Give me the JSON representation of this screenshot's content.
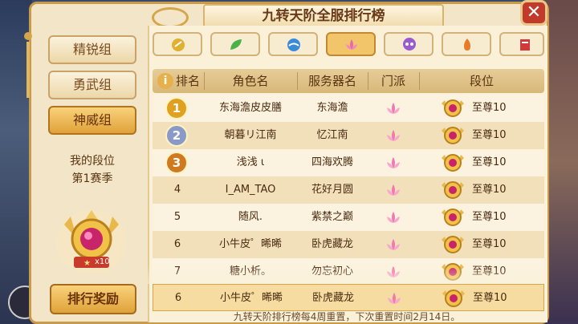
{
  "window": {
    "title": "九转天阶全服排行榜",
    "close_label": "✕"
  },
  "groups": [
    {
      "label": "精锐组",
      "active": false
    },
    {
      "label": "勇武组",
      "active": false
    },
    {
      "label": "神威组",
      "active": true
    }
  ],
  "my_rank": {
    "label": "我的段位",
    "season": "第1赛季",
    "star_count": "x10"
  },
  "reward_button": "排行奖励",
  "sect_tabs": [
    {
      "icon": "gold-orb-icon",
      "color": "#e0b030"
    },
    {
      "icon": "green-leaf-icon",
      "color": "#4ab04a"
    },
    {
      "icon": "blue-wave-icon",
      "color": "#3a8ad8"
    },
    {
      "icon": "pink-lotus-icon",
      "color": "#e86aa8",
      "active": true
    },
    {
      "icon": "purple-skull-icon",
      "color": "#9a5ad0"
    },
    {
      "icon": "orange-flame-icon",
      "color": "#e87a2a"
    },
    {
      "icon": "red-banner-icon",
      "color": "#d03a3a"
    }
  ],
  "table": {
    "headers": {
      "info": "i",
      "rank": "排名",
      "name": "角色名",
      "server": "服务器名",
      "sect": "门派",
      "tier": "段位"
    },
    "rows": [
      {
        "rank": "1",
        "name": "东海澹皮皮膳",
        "server": "东海澹",
        "tier": "至尊10",
        "medal": "gold"
      },
      {
        "rank": "2",
        "name": "朝暮リ江南",
        "server": "忆江南",
        "tier": "至尊10",
        "medal": "silver"
      },
      {
        "rank": "3",
        "name": "浅浅 ι",
        "server": "四海欢腾",
        "tier": "至尊10",
        "medal": "bronze"
      },
      {
        "rank": "4",
        "name": "I_AM_TAO",
        "server": "花好月圆",
        "tier": "至尊10",
        "medal": ""
      },
      {
        "rank": "5",
        "name": "随风.",
        "server": "紫禁之巅",
        "tier": "至尊10",
        "medal": ""
      },
      {
        "rank": "6",
        "name": "小牛皮゜晞晞",
        "server": "卧虎藏龙",
        "tier": "至尊10",
        "medal": ""
      },
      {
        "rank": "7",
        "name": "糖小析。",
        "server": "勿忘初心",
        "tier": "至尊10",
        "medal": ""
      }
    ],
    "my_row": {
      "rank": "6",
      "name": "小牛皮゜晞晞",
      "server": "卧虎藏龙",
      "tier": "至尊10"
    }
  },
  "footer": "九转天阶排行榜每4周重置，下次重置时间2月14日。"
}
